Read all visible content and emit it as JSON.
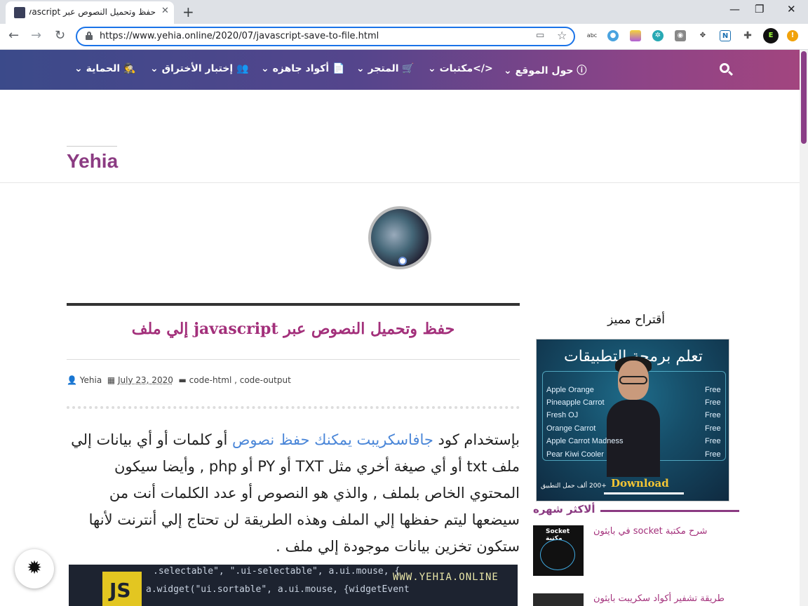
{
  "browser": {
    "tab_title": "حفظ وتحميل النصوص عبر javascript",
    "tab_close": "✕",
    "new_tab": "+",
    "window_minimize": "—",
    "window_restore": "❐",
    "window_close": "✕",
    "back": "←",
    "forward": "→",
    "reload": "↻",
    "url": "https://www.yehia.online/2020/07/javascript-save-to-file.html",
    "extensions": [
      "abc-icon",
      "search-ext-icon",
      "highlight-ext-icon",
      "gear-ext-icon",
      "camera-icon",
      "move-icon",
      "n-ext-icon",
      "puzzle-icon",
      "profile-icon",
      "alert-icon"
    ]
  },
  "nav": {
    "items": [
      {
        "label": "ⓘ حول الموقع ⌄"
      },
      {
        "label": "</>مكتبات ⌄"
      },
      {
        "label": "🛒 المتجر ⌄"
      },
      {
        "label": "📄 أكواد جاهزه ⌄"
      },
      {
        "label": "👥 إختبار الأختراق ⌄"
      },
      {
        "label": "🕵 الحماية ⌄"
      }
    ]
  },
  "site": {
    "brand": "Yehia"
  },
  "post": {
    "title": "حفظ وتحميل النصوص عبر javascript إلي ملف",
    "meta": {
      "author": "Yehia",
      "date": "July 23, 2020",
      "labels": "code-html , code-output"
    },
    "body": {
      "prefix": "بإستخدام كود ",
      "link": "جافاسكريبت يمكنك حفظ نصوص",
      "rest": " أو كلمات أو أي بيانات إلي ملف txt أو أي صيغة أخري مثل TXT أو PY أو php , وأيضا سيكون المحتوي الخاص بلملف , والذي هو النصوص أو عدد الكلمات أنت من سيضعها ليتم حفظها إلي الملف وهذه الطريقة لن تحتاج إلي أنترنت لأنها ستكون تخزين بيانات موجودة إلي ملف ."
    },
    "image": {
      "code_line1": ".selectable\", \".ui-selectable\", a.ui.mouse, {",
      "code_line2": "a.widget(\"ui.sortable\", a.ui.mouse, {widgetEvent",
      "watermark": "WWW.YEHIA.ONLINE"
    }
  },
  "sidebar": {
    "featured_heading": "أقتراح مميز",
    "ad": {
      "title": "تعلم برمجة التطبيقات",
      "rows": [
        {
          "left": "Apple Orange",
          "right": "Free"
        },
        {
          "left": "Pineapple Carrot",
          "right": "Free"
        },
        {
          "left": "Fresh OJ",
          "right": "Free"
        },
        {
          "left": "Orange Carrot",
          "right": "Free"
        },
        {
          "left": "Apple Carrot Madness",
          "right": "Free"
        },
        {
          "left": "Pear Kiwi Cooler",
          "right": "Free"
        }
      ],
      "count": "+200 ألف حمل التطبيق",
      "download": "Download"
    },
    "popular_heading": "ألاكثر شهره",
    "popular": [
      {
        "title": "شرح مكتبة socket في بايثون",
        "thumb_label": "Socket مكتبة"
      },
      {
        "title": "طريقة تشفير أكواد سكريبت بايثون",
        "thumb_label": ""
      }
    ]
  },
  "colors": {
    "accent": "#8b3b82",
    "title": "#a3307b",
    "link": "#4a86d8"
  }
}
